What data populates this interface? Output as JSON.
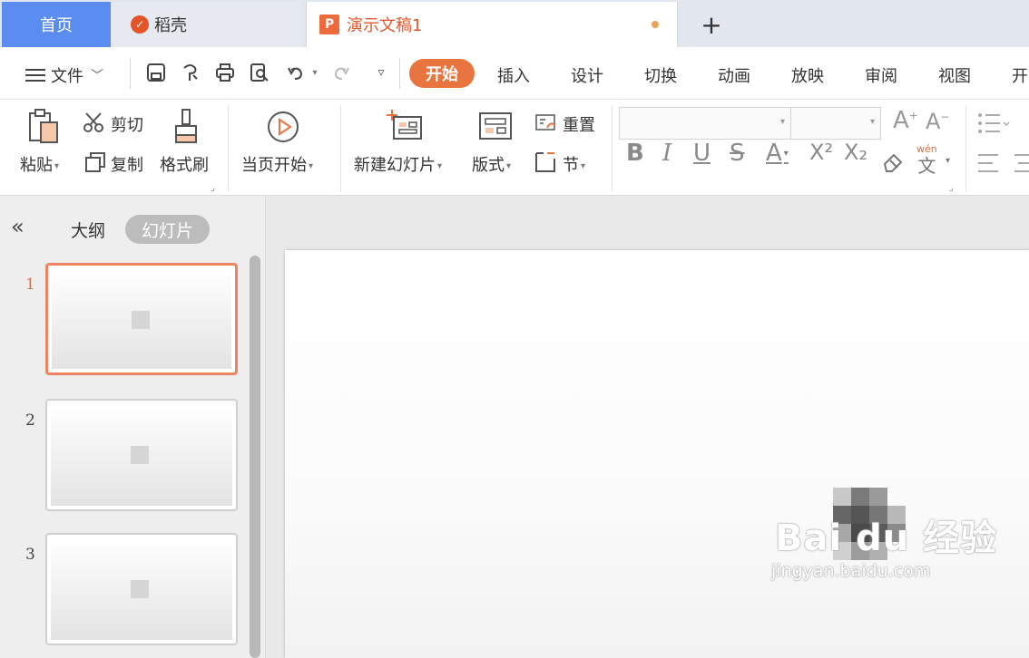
{
  "tabs": {
    "home": "首页",
    "daoke": "稻壳",
    "doc": "演示文稿1",
    "add": "+"
  },
  "menu": {
    "file": "文件",
    "tabs": [
      "开始",
      "插入",
      "设计",
      "切换",
      "动画",
      "放映",
      "审阅",
      "视图",
      "开"
    ]
  },
  "ribbon": {
    "paste": "粘贴",
    "cut": "剪切",
    "copy": "复制",
    "format_painter": "格式刷",
    "play_current": "当页开始",
    "new_slide": "新建幻灯片",
    "layout": "版式",
    "reset": "重置",
    "section": "节",
    "font_labels": [
      "B",
      "I",
      "U",
      "S",
      "A",
      "X²",
      "X₂"
    ],
    "phonetic": "wén"
  },
  "sidebar": {
    "collapse": "«",
    "outline": "大纲",
    "slides": "幻灯片",
    "thumbnails": [
      "1",
      "2",
      "3"
    ]
  },
  "watermark": {
    "main": "Bai du 经验",
    "url": "jingyan.baidu.com"
  },
  "colors": {
    "accent": "#e8743f",
    "home_tab": "#5b8cf0"
  }
}
